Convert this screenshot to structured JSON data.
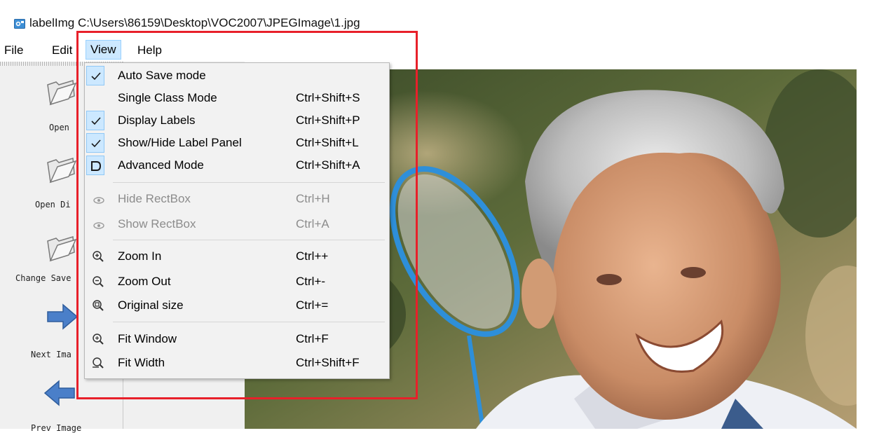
{
  "window": {
    "title": "labelImg C:\\Users\\86159\\Desktop\\VOC2007\\JPEGImage\\1.jpg",
    "icon": "labelimg-app-icon"
  },
  "menubar": {
    "items": [
      {
        "label": "File"
      },
      {
        "label": "Edit"
      },
      {
        "label": "View",
        "active": true
      },
      {
        "label": "Help"
      }
    ]
  },
  "toolbar": {
    "items": [
      {
        "label": "Open",
        "icon": "folder-open-icon"
      },
      {
        "label": "Open Di",
        "icon": "folder-open-icon"
      },
      {
        "label": "Change Save",
        "icon": "folder-open-icon"
      },
      {
        "label": "Next Ima",
        "icon": "arrow-right-icon"
      },
      {
        "label": "Prev Image",
        "icon": "arrow-left-icon"
      }
    ]
  },
  "view_menu": {
    "items": [
      {
        "label": "Auto Save mode",
        "shortcut": "",
        "checked": true,
        "icon": "check-icon",
        "enabled": true
      },
      {
        "label": "Single Class Mode",
        "shortcut": "Ctrl+Shift+S",
        "checked": false,
        "icon": "",
        "enabled": true
      },
      {
        "label": "Display Labels",
        "shortcut": "Ctrl+Shift+P",
        "checked": true,
        "icon": "check-icon",
        "enabled": true
      },
      {
        "label": "Show/Hide Label Panel",
        "shortcut": "Ctrl+Shift+L",
        "checked": true,
        "icon": "check-icon",
        "enabled": true
      },
      {
        "label": "Advanced Mode",
        "shortcut": "Ctrl+Shift+A",
        "checked": true,
        "icon": "advanced-mode-icon",
        "enabled": true
      },
      {
        "label": "Hide RectBox",
        "shortcut": "Ctrl+H",
        "checked": false,
        "icon": "eye-icon",
        "enabled": false
      },
      {
        "label": "Show RectBox",
        "shortcut": "Ctrl+A",
        "checked": false,
        "icon": "eye-icon",
        "enabled": false
      },
      {
        "label": "Zoom In",
        "shortcut": "Ctrl++",
        "checked": false,
        "icon": "zoom-in-icon",
        "enabled": true
      },
      {
        "label": "Zoom Out",
        "shortcut": "Ctrl+-",
        "checked": false,
        "icon": "zoom-out-icon",
        "enabled": true
      },
      {
        "label": "Original size",
        "shortcut": "Ctrl+=",
        "checked": false,
        "icon": "zoom-original-icon",
        "enabled": true
      },
      {
        "label": "Fit Window",
        "shortcut": "Ctrl+F",
        "checked": false,
        "icon": "fit-window-icon",
        "enabled": true
      },
      {
        "label": "Fit Width",
        "shortcut": "Ctrl+Shift+F",
        "checked": false,
        "icon": "fit-width-icon",
        "enabled": true
      }
    ]
  },
  "colors": {
    "highlight_border": "#e8202a",
    "menu_active_bg": "#cce8ff",
    "menu_bg": "#f2f2f2",
    "toolbar_bg": "#f0f0f0",
    "arrow_blue": "#4a7fc9"
  }
}
